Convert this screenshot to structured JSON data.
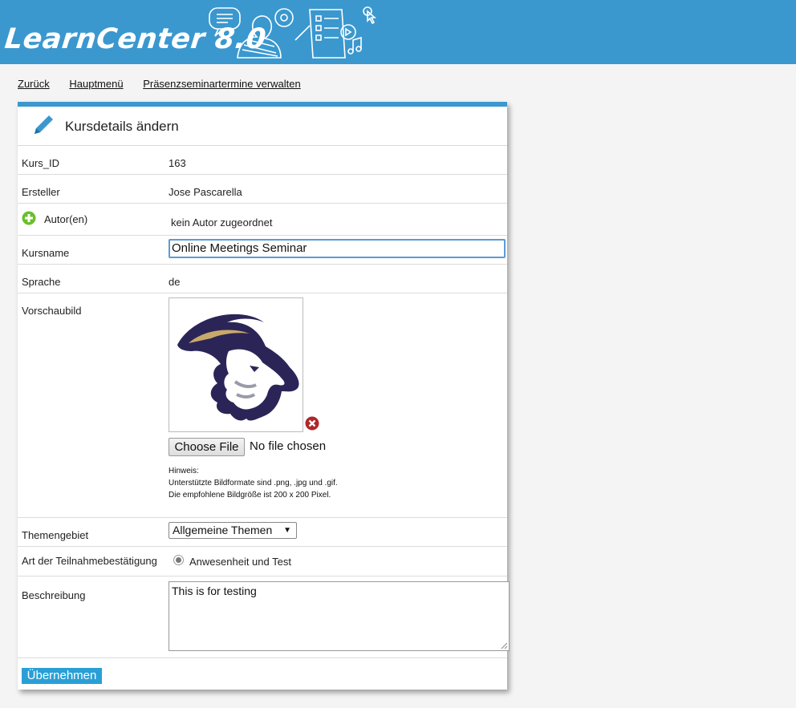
{
  "header": {
    "logo_text": "LearnCenter 8.0"
  },
  "nav": {
    "back": "Zurück",
    "main_menu": "Hauptmenü",
    "manage": "Präsenzseminartermine verwalten"
  },
  "panel": {
    "title": "Kursdetails ändern",
    "course_id": {
      "label": "Kurs_ID",
      "value": "163"
    },
    "creator": {
      "label": "Ersteller",
      "value": "Jose Pascarella"
    },
    "authors": {
      "label": "Autor(en)",
      "value": "kein Autor zugeordnet"
    },
    "course_name": {
      "label": "Kursname",
      "value": "Online Meetings Seminar"
    },
    "language": {
      "label": "Sprache",
      "value": "de"
    },
    "preview": {
      "label": "Vorschaubild",
      "file_button": "Choose File",
      "file_status": "No file chosen",
      "hint_title": "Hinweis:",
      "hint_formats": "Unterstützte Bildformate sind .png, .jpg und .gif.",
      "hint_size": "Die empfohlene Bildgröße ist 200 x 200 Pixel."
    },
    "topic": {
      "label": "Themengebiet",
      "value": "Allgemeine Themen"
    },
    "confirmation": {
      "label": "Art der Teilnahmebestätigung",
      "option": "Anwesenheit und Test"
    },
    "description": {
      "label": "Beschreibung",
      "value": "This is for testing"
    },
    "submit": "Übernehmen"
  },
  "icons": {
    "header_art": "e-learning-illustration-icon",
    "pencil": "pencil-icon",
    "add": "add-author-icon",
    "remove": "remove-image-icon"
  },
  "colors": {
    "header": "#3a98cf",
    "panel_border": "#3a98cf",
    "submit_button": "#2a9fd6",
    "add_icon": "#6abf2a",
    "remove_icon": "#b0262a"
  }
}
